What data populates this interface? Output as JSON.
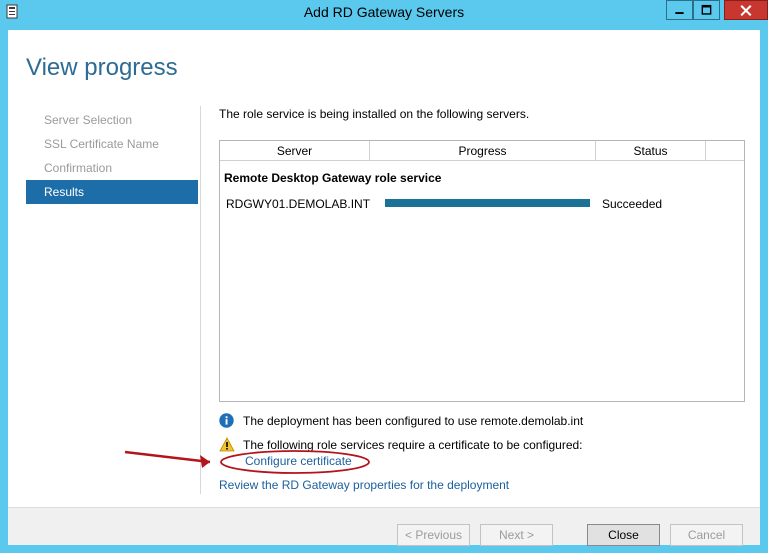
{
  "window": {
    "title": "Add RD Gateway Servers"
  },
  "header": {
    "title": "View progress"
  },
  "nav": {
    "items": [
      {
        "label": "Server Selection",
        "active": false
      },
      {
        "label": "SSL Certificate Name",
        "active": false
      },
      {
        "label": "Confirmation",
        "active": false
      },
      {
        "label": "Results",
        "active": true
      }
    ]
  },
  "main": {
    "intro": "The role service is being installed on the following servers.",
    "table": {
      "columns": [
        "Server",
        "Progress",
        "Status"
      ],
      "group": "Remote Desktop Gateway role service",
      "rows": [
        {
          "server": "RDGWY01.DEMOLAB.INT",
          "progress": 1.0,
          "status": "Succeeded"
        }
      ]
    },
    "info_message": "The deployment has been configured to use remote.demolab.int",
    "warning_message": "The following role services require a certificate to be configured:",
    "configure_link": "Configure certificate",
    "review_link": "Review the RD Gateway properties for the deployment"
  },
  "footer": {
    "previous": "< Previous",
    "next": "Next >",
    "close": "Close",
    "cancel": "Cancel"
  },
  "colors": {
    "titlebar": "#5bc8ee",
    "header_text": "#2d6b95",
    "nav_active": "#1d6ea8",
    "progress_fill": "#1c7196",
    "link": "#1a5f9e",
    "annotation": "#b3141c"
  }
}
